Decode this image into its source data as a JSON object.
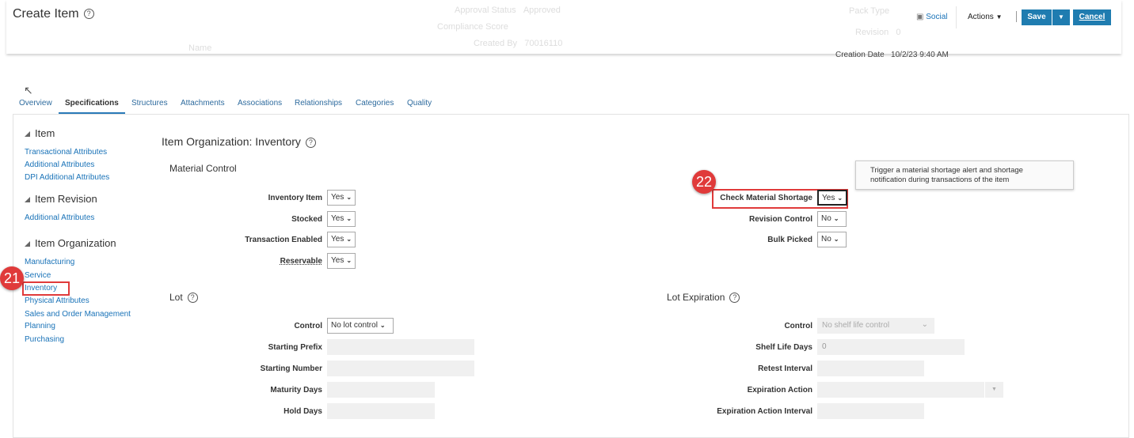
{
  "header": {
    "title": "Create Item",
    "bg_fields": [
      {
        "label": "Approval Status",
        "value": "Approved"
      },
      {
        "label": "Compliance Score",
        "value": ""
      },
      {
        "label": "Created By",
        "value": "70016110"
      },
      {
        "label": "Name",
        "value": ""
      },
      {
        "label": "Pack Type",
        "value": ""
      },
      {
        "label": "Revision",
        "value": "0"
      },
      {
        "label": "Creation Date",
        "value": "10/2/23 9:40 AM"
      }
    ],
    "social": "Social",
    "actions": "Actions",
    "save": "Save",
    "cancel": "Cancel"
  },
  "tabs": [
    "Overview",
    "Specifications",
    "Structures",
    "Attachments",
    "Associations",
    "Relationships",
    "Categories",
    "Quality"
  ],
  "sidebar": {
    "groups": [
      {
        "title": "Item",
        "links": [
          "Transactional Attributes",
          "Additional Attributes",
          "DPI Additional Attributes"
        ]
      },
      {
        "title": "Item Revision",
        "links": [
          "Additional Attributes"
        ]
      },
      {
        "title": "Item Organization",
        "links": [
          "Manufacturing",
          "Service",
          "Inventory",
          "Physical Attributes",
          "Sales and Order Management",
          "Planning",
          "Purchasing"
        ]
      }
    ]
  },
  "main": {
    "title": "Item Organization: Inventory",
    "material_control": {
      "title": "Material Control",
      "left": [
        {
          "label": "Inventory Item",
          "value": "Yes"
        },
        {
          "label": "Stocked",
          "value": "Yes"
        },
        {
          "label": "Transaction Enabled",
          "value": "Yes"
        },
        {
          "label": "Reservable",
          "value": "Yes"
        }
      ],
      "right": [
        {
          "label": "Check Material Shortage",
          "value": "Yes"
        },
        {
          "label": "Revision Control",
          "value": "No"
        },
        {
          "label": "Bulk Picked",
          "value": "No"
        }
      ]
    },
    "tooltip": "Trigger a material shortage alert and shortage notification during transactions of the item",
    "lot": {
      "title": "Lot",
      "fields": [
        {
          "label": "Control",
          "value": "No lot control"
        },
        {
          "label": "Starting Prefix",
          "value": ""
        },
        {
          "label": "Starting Number",
          "value": ""
        },
        {
          "label": "Maturity Days",
          "value": ""
        },
        {
          "label": "Hold Days",
          "value": ""
        }
      ]
    },
    "lot_expiration": {
      "title": "Lot Expiration",
      "fields": [
        {
          "label": "Control",
          "value": "No shelf life control"
        },
        {
          "label": "Shelf Life Days",
          "value": "0"
        },
        {
          "label": "Retest Interval",
          "value": ""
        },
        {
          "label": "Expiration Action",
          "value": ""
        },
        {
          "label": "Expiration Action Interval",
          "value": ""
        }
      ]
    }
  },
  "callouts": {
    "a": "21",
    "b": "22"
  },
  "colors": {
    "accent": "#1f7cb0",
    "callout": "#e03a3a"
  }
}
